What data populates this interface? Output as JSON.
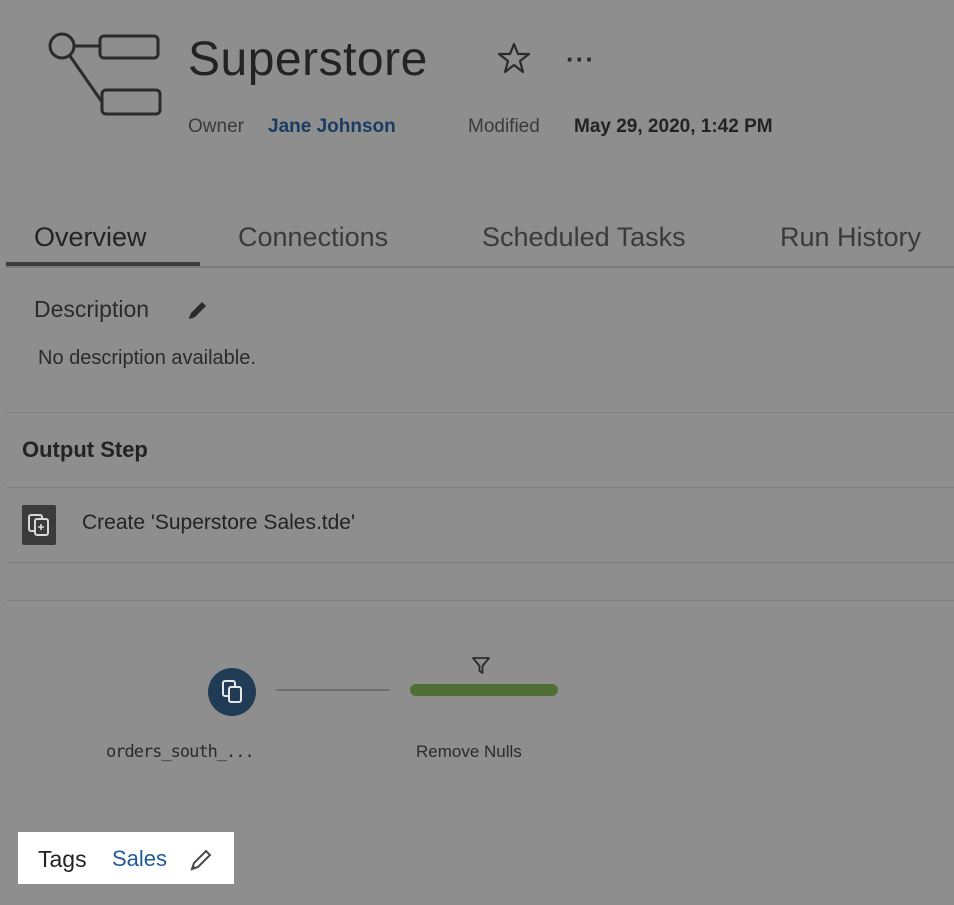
{
  "header": {
    "title": "Superstore",
    "owner_label": "Owner",
    "owner_name": "Jane Johnson",
    "modified_label": "Modified",
    "modified_date": "May 29, 2020, 1:42 PM",
    "more_label": "···",
    "icons": {
      "flow": "flow-icon",
      "favorite": "star-icon",
      "more": "more-icon"
    }
  },
  "tabs": [
    {
      "label": "Overview",
      "active": true
    },
    {
      "label": "Connections",
      "active": false
    },
    {
      "label": "Scheduled Tasks",
      "active": false
    },
    {
      "label": "Run History",
      "active": false
    }
  ],
  "description": {
    "label": "Description",
    "text": "No description available."
  },
  "output_step": {
    "heading": "Output Step",
    "item": "Create 'Superstore Sales.tde'"
  },
  "flow": {
    "nodes": [
      {
        "label": "orders_south_..."
      },
      {
        "label": "Remove Nulls"
      }
    ]
  },
  "tags": {
    "label": "Tags",
    "value": "Sales"
  },
  "colors": {
    "overlay_bg": "#8e8e8e",
    "link": "#1a3c63",
    "flow_node": "#1f3b55",
    "flow_bar": "#4f6e35",
    "tag_link": "#1f5b96"
  }
}
